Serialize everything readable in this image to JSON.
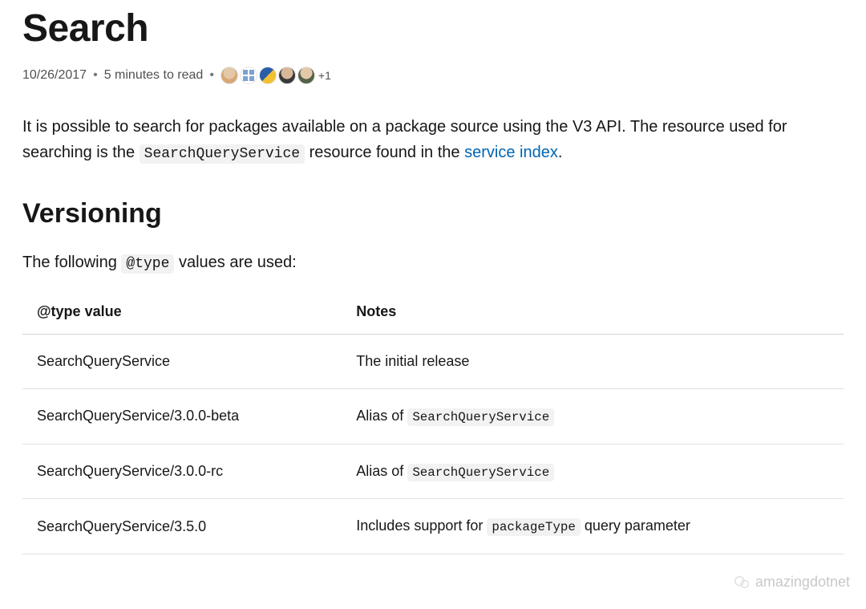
{
  "page_title": "Search",
  "meta": {
    "date": "10/26/2017",
    "read_time": "5 minutes to read",
    "contributor_overflow": "+1"
  },
  "intro": {
    "text_before_code": "It is possible to search for packages available on a package source using the V3 API. The resource used for searching is the ",
    "code": "SearchQueryService",
    "text_after_code": " resource found in the ",
    "link_text": "service index",
    "text_end": "."
  },
  "versioning": {
    "heading": "Versioning",
    "intro_before": "The following ",
    "intro_code": "@type",
    "intro_after": " values are used:",
    "table": {
      "headers": [
        "@type value",
        "Notes"
      ],
      "rows": [
        {
          "type_value": "SearchQueryService",
          "note_text": "The initial release",
          "note_code": null,
          "note_text_after": null
        },
        {
          "type_value": "SearchQueryService/3.0.0-beta",
          "note_text": "Alias of ",
          "note_code": "SearchQueryService",
          "note_text_after": null
        },
        {
          "type_value": "SearchQueryService/3.0.0-rc",
          "note_text": "Alias of ",
          "note_code": "SearchQueryService",
          "note_text_after": null
        },
        {
          "type_value": "SearchQueryService/3.5.0",
          "note_text": "Includes support for ",
          "note_code": "packageType",
          "note_text_after": " query parameter"
        }
      ]
    }
  },
  "watermark": "amazingdotnet"
}
